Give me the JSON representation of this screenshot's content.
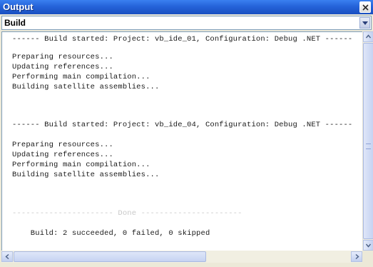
{
  "window": {
    "title": "Output",
    "close_label": "close"
  },
  "dropdown": {
    "selected": "Build"
  },
  "output": {
    "lines": [
      "------ Build started: Project: vb_ide_01, Configuration: Debug .NET ------",
      "Preparing resources...",
      "Updating references...",
      "Performing main compilation...",
      "Building satellite assemblies...",
      "------ Build started: Project: vb_ide_04, Configuration: Debug .NET ------",
      "Preparing resources...",
      "Updating references...",
      "Performing main compilation...",
      "Building satellite assemblies...",
      "---------------------- Done ----------------------",
      "    Build: 2 succeeded, 0 failed, 0 skipped"
    ]
  },
  "colors": {
    "titlebar": "#2563d9",
    "accent": "#7f9db9"
  }
}
